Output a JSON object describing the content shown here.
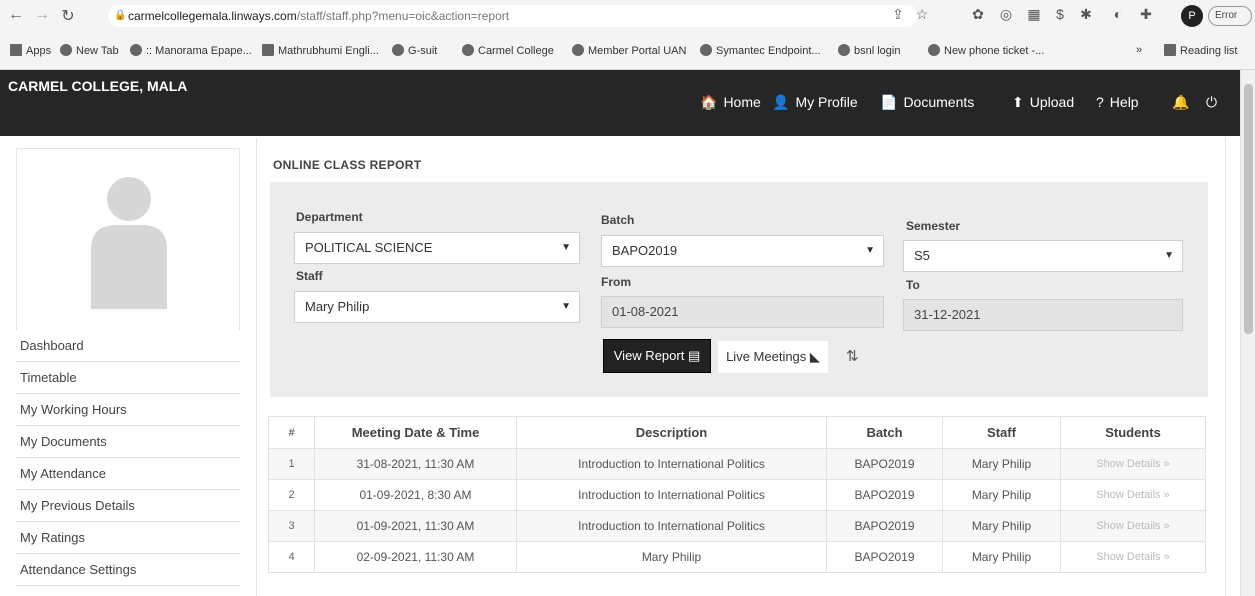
{
  "browser": {
    "url_domain": "carmelcollegemala.linways.com",
    "url_path": "/staff/staff.php?menu=oic&action=report",
    "profile_letter": "P",
    "error_label": "Error",
    "bookmarks": [
      "Apps",
      "New Tab",
      ":: Manorama Epape...",
      "Mathrubhumi Engli...",
      "G-suit",
      "Carmel College",
      "Member Portal UAN",
      "Symantec Endpoint...",
      "bsnl login",
      "New phone ticket -..."
    ],
    "more_label": "»",
    "reading_list": "Reading list"
  },
  "header": {
    "brand": "CARMEL COLLEGE, MALA",
    "nav": [
      {
        "icon": "home-icon",
        "glyph": "🏠",
        "label": "Home"
      },
      {
        "icon": "user-icon",
        "glyph": "👤",
        "label": "My Profile"
      },
      {
        "icon": "document-icon",
        "glyph": "📄",
        "label": "Documents"
      },
      {
        "icon": "upload-icon",
        "glyph": "⬆",
        "label": "Upload"
      },
      {
        "icon": "help-icon",
        "glyph": "?",
        "label": "Help"
      }
    ]
  },
  "sidebar": {
    "items": [
      "Dashboard",
      "Timetable",
      "My Working Hours",
      "My Documents",
      "My Attendance",
      "My Previous Details",
      "My Ratings",
      "Attendance Settings"
    ]
  },
  "report": {
    "title": "ONLINE CLASS REPORT",
    "filters": {
      "department_label": "Department",
      "department_value": "POLITICAL SCIENCE",
      "batch_label": "Batch",
      "batch_value": "BAPO2019",
      "semester_label": "Semester",
      "semester_value": "S5",
      "staff_label": "Staff",
      "staff_value": "Mary Philip",
      "from_label": "From",
      "from_value": "01-08-2021",
      "to_label": "To",
      "to_value": "31-12-2021"
    },
    "buttons": {
      "view_report": "View Report",
      "live_meetings": "Live Meetings"
    },
    "table": {
      "headers": [
        "#",
        "Meeting Date & Time",
        "Description",
        "Batch",
        "Staff",
        "Students"
      ],
      "rows": [
        [
          "1",
          "31-08-2021, 11:30 AM",
          "Introduction to International Politics",
          "BAPO2019",
          "Mary Philip",
          "Show Details »"
        ],
        [
          "2",
          "01-09-2021, 8:30 AM",
          "Introduction to International Politics",
          "BAPO2019",
          "Mary Philip",
          "Show Details »"
        ],
        [
          "3",
          "01-09-2021, 11:30 AM",
          "Introduction to International Politics",
          "BAPO2019",
          "Mary Philip",
          "Show Details »"
        ],
        [
          "4",
          "02-09-2021, 11:30 AM",
          "Mary Philip",
          "BAPO2019",
          "Mary Philip",
          "Show Details »"
        ]
      ]
    }
  }
}
